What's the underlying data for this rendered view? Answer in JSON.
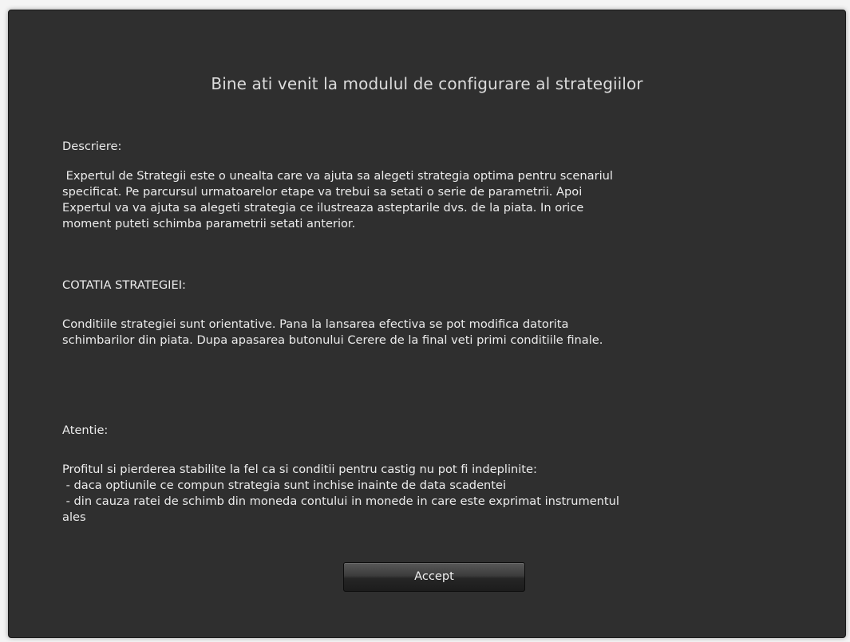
{
  "dialog": {
    "title": "Bine ati venit la modulul de configurare al strategiilor",
    "description_heading": "Descriere:",
    "description_body": " Expertul de Strategii este o unealta care va ajuta sa alegeti strategia optima pentru scenariul\nspecificat. Pe parcursul urmatoarelor etape va trebui sa setati o serie de parametrii. Apoi\nExpertul va va ajuta sa alegeti strategia ce ilustreaza asteptarile dvs. de la piata. In orice\nmoment puteti schimba parametrii setati anterior.",
    "quote_heading": "COTATIA STRATEGIEI:",
    "quote_body": "Conditiile strategiei sunt orientative. Pana la lansarea efectiva se pot modifica datorita\nschimbarilor din piata. Dupa apasarea butonului Cerere de la final veti primi conditiile finale.",
    "warning_heading": "Atentie:",
    "warning_body": "Profitul si pierderea stabilite la fel ca si conditii pentru castig nu pot fi indeplinite:\n - daca optiunile ce compun strategia sunt inchise inainte de data scadentei\n - din cauza ratei de schimb din moneda contului in monede in care este exprimat instrumentul\nales",
    "accept_label": "Accept"
  }
}
